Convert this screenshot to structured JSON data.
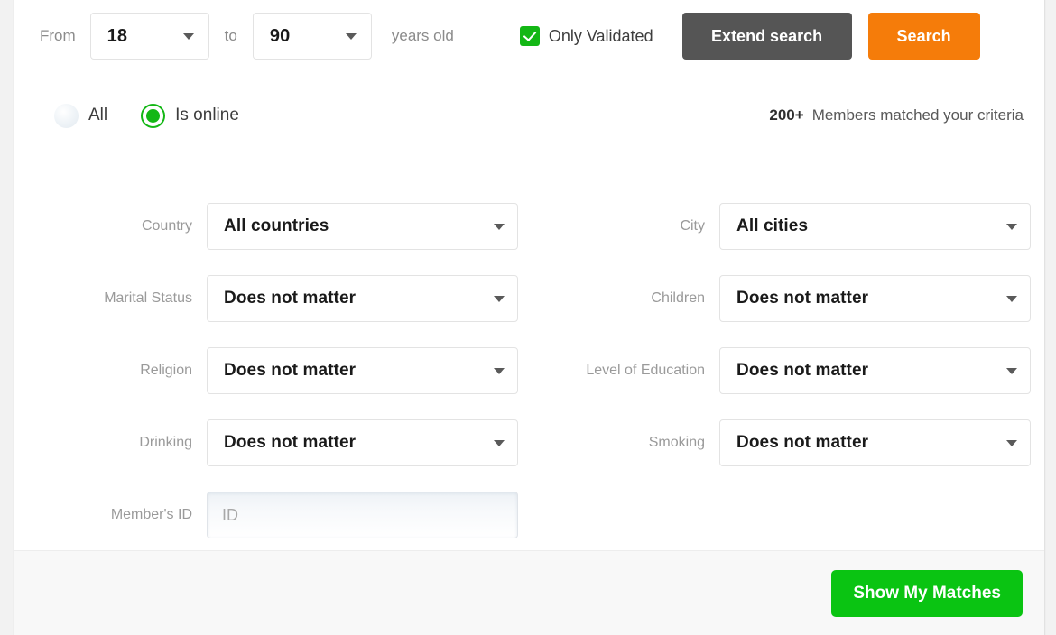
{
  "age_filter": {
    "from_label": "From",
    "from_value": "18",
    "to_label": "to",
    "to_value": "90",
    "units_label": "years old"
  },
  "validated": {
    "label": "Only Validated",
    "checked": true
  },
  "actions": {
    "extend_search": "Extend search",
    "search": "Search",
    "show_matches": "Show My Matches"
  },
  "online_filter": {
    "all_label": "All",
    "online_label": "Is online",
    "selected": "Is online"
  },
  "results": {
    "count": "200+",
    "text": "Members matched your criteria"
  },
  "filters": {
    "rows": [
      {
        "left": {
          "label": "Country",
          "value": "All countries"
        },
        "right": {
          "label": "City",
          "value": "All cities"
        }
      },
      {
        "left": {
          "label": "Marital Status",
          "value": "Does not matter"
        },
        "right": {
          "label": "Children",
          "value": "Does not matter"
        }
      },
      {
        "left": {
          "label": "Religion",
          "value": "Does not matter"
        },
        "right": {
          "label": "Level of Education",
          "value": "Does not matter"
        }
      },
      {
        "left": {
          "label": "Drinking",
          "value": "Does not matter"
        },
        "right": {
          "label": "Smoking",
          "value": "Does not matter"
        }
      }
    ],
    "member_id": {
      "label": "Member's ID",
      "placeholder": "ID",
      "value": ""
    }
  },
  "colors": {
    "orange": "#f57c0a",
    "dark_gray": "#555555",
    "green": "#0ac412",
    "check_green": "#13b715"
  }
}
